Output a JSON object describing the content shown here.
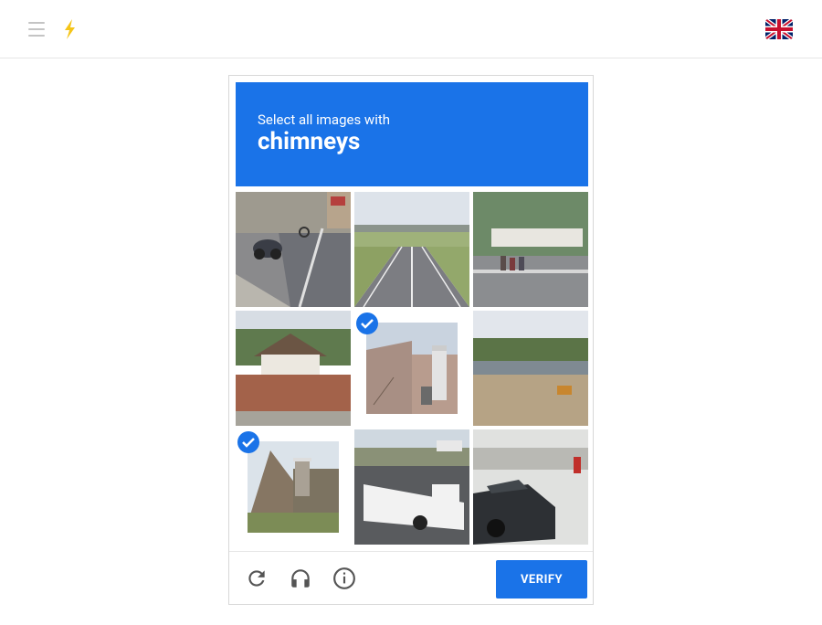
{
  "topbar": {
    "menu_icon": "hamburger-icon",
    "logo_icon": "lightning-icon",
    "language_flag": "uk-flag-icon"
  },
  "challenge": {
    "prompt": "Select all images with",
    "target": "chimneys",
    "tiles": [
      {
        "index": 1,
        "scene": "bike lane with motorcycles",
        "selected": false
      },
      {
        "index": 2,
        "scene": "highway with overpass",
        "selected": false
      },
      {
        "index": 3,
        "scene": "crosswalk with people",
        "selected": false
      },
      {
        "index": 4,
        "scene": "house behind brick wall",
        "selected": false
      },
      {
        "index": 5,
        "scene": "house with chimney",
        "selected": true
      },
      {
        "index": 6,
        "scene": "construction site near water",
        "selected": false
      },
      {
        "index": 7,
        "scene": "roof with chimney",
        "selected": true
      },
      {
        "index": 8,
        "scene": "white pickup truck",
        "selected": false
      },
      {
        "index": 9,
        "scene": "parked car in snow",
        "selected": false
      }
    ]
  },
  "footer": {
    "refresh_icon": "refresh-icon",
    "audio_icon": "headphones-icon",
    "info_icon": "info-icon",
    "verify_label": "VERIFY"
  },
  "colors": {
    "accent": "#1a73e8",
    "border": "#d8d8d8"
  }
}
